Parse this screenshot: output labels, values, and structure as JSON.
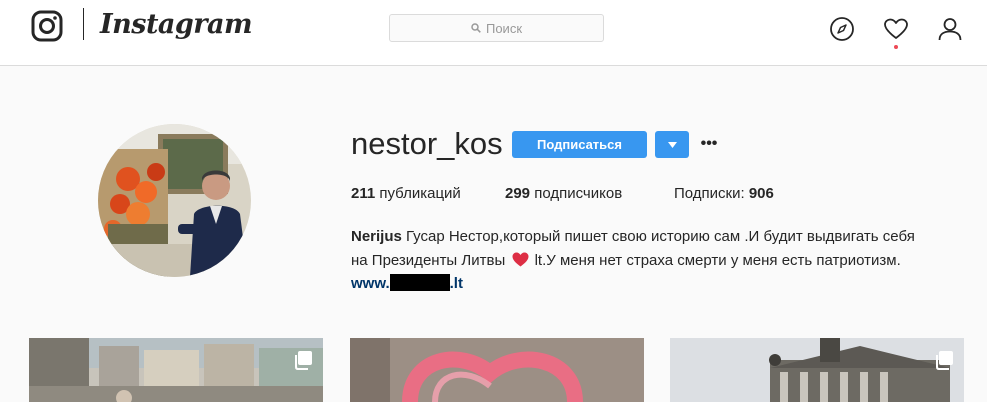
{
  "header": {
    "wordmark": "Instagram",
    "search_placeholder": "Поиск",
    "icons": [
      "instagram-logo-icon",
      "compass-icon",
      "heart-icon",
      "profile-icon"
    ],
    "accent_color": "#3897f0",
    "notification_dot_color": "#ed4956"
  },
  "profile": {
    "username": "nestor_kos",
    "follow_label": "Подписаться",
    "more_label": "•••",
    "stats": {
      "posts_count": "211",
      "posts_label": "публикаций",
      "followers_count": "299",
      "followers_label": "подписчиков",
      "following_label": "Подписки:",
      "following_count": "906"
    },
    "bio": {
      "name": "Nerijus",
      "line1": "Гусар Нестор,который пишет свою историю сам .И будит выдвигать себя",
      "line2_pre": "на Президенты Литвы",
      "line2_post": "lt.У меня нет страха смерти у меня есть патриотизм.",
      "link_prefix": "www.",
      "link_suffix": ".lt"
    }
  },
  "posts": [
    {
      "multi": true
    },
    {
      "multi": false
    },
    {
      "multi": true
    }
  ]
}
